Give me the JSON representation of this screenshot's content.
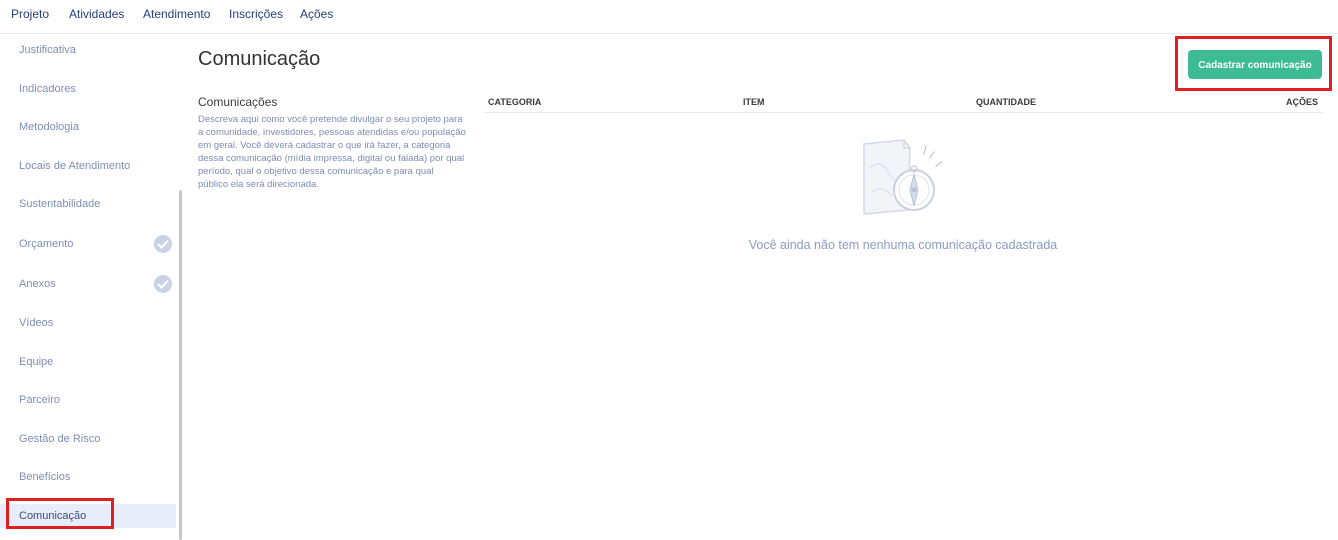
{
  "topnav": {
    "items": [
      "Projeto",
      "Atividades",
      "Atendimento",
      "Inscrições",
      "Ações"
    ]
  },
  "sidebar": {
    "items": [
      {
        "label": "Justificativa"
      },
      {
        "label": "Indicadores"
      },
      {
        "label": "Metodologia"
      },
      {
        "label": "Locais de Atendimento"
      },
      {
        "label": "Sustentabilidade"
      },
      {
        "label": "Orçamento",
        "checked": true
      },
      {
        "label": "Anexos",
        "checked": true
      },
      {
        "label": "Vídeos"
      },
      {
        "label": "Equipe"
      },
      {
        "label": "Parceiro"
      },
      {
        "label": "Gestão de Risco"
      },
      {
        "label": "Benefícios"
      },
      {
        "label": "Comunicação",
        "active": true
      }
    ]
  },
  "main": {
    "title": "Comunicação",
    "add_button": "Cadastrar comunicação",
    "section_title": "Comunicações",
    "section_description": "Descreva aqui como você pretende divulgar o seu projeto para a comunidade, investidores, pessoas atendidas e/ou população em geral. Você deverá cadastrar o que irá fazer, a categoria dessa comunicação (mídia impressa, digital ou falada) por qual período, qual o objetivo dessa comunicação e para qual público ela será direcionada.",
    "table": {
      "columns": [
        "CATEGORIA",
        "ITEM",
        "QUANTIDADE",
        "AÇÕES"
      ],
      "empty_message": "Você ainda não tem nenhuma comunicação cadastrada"
    }
  },
  "colors": {
    "nav_text": "#25407a",
    "sidebar_text": "#7c8db5",
    "accent_green": "#3dbb93",
    "highlight_red": "#e02020",
    "active_bg": "#e8edfb"
  }
}
